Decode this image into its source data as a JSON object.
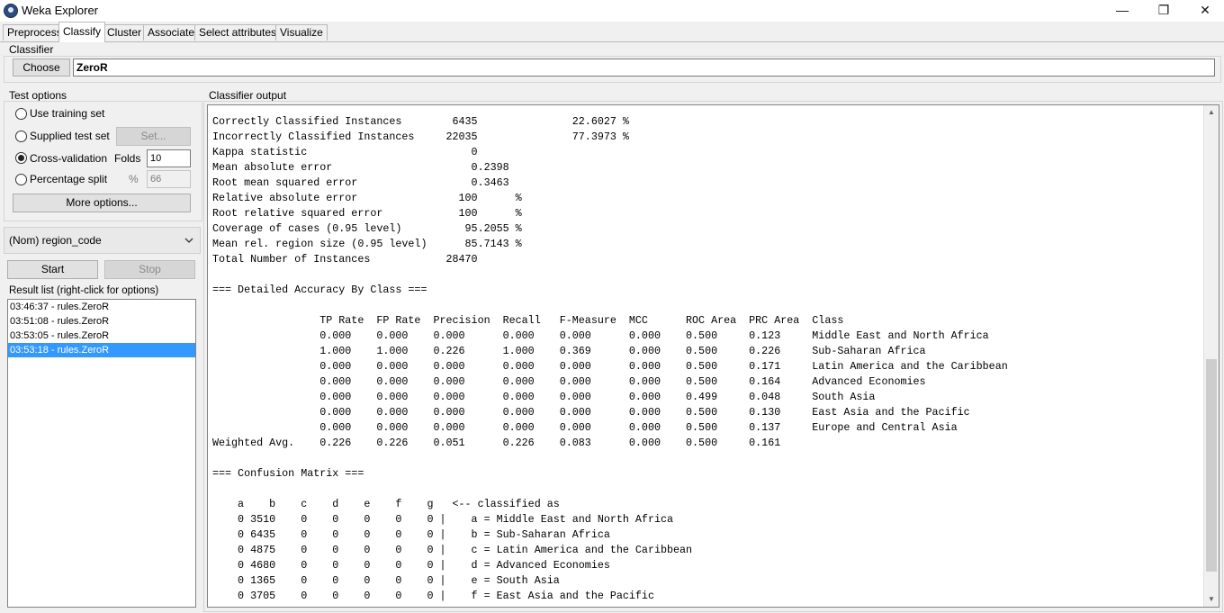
{
  "window": {
    "title": "Weka Explorer",
    "minimize": "—",
    "restore": "❐",
    "close": "✕"
  },
  "tabs": [
    "Preprocess",
    "Classify",
    "Cluster",
    "Associate",
    "Select attributes",
    "Visualize"
  ],
  "active_tab": "Classify",
  "classifier": {
    "group_label": "Classifier",
    "choose_label": "Choose",
    "name": "ZeroR"
  },
  "test_options": {
    "group_label": "Test options",
    "use_training_set": "Use training set",
    "supplied_test_set": "Supplied test set",
    "set_button": "Set...",
    "cross_validation": "Cross-validation",
    "folds_label": "Folds",
    "folds_value": "10",
    "percentage_split": "Percentage split",
    "percent_symbol": "%",
    "percent_value": "66",
    "more_options": "More options...",
    "selected": "Cross-validation"
  },
  "class_attribute": {
    "value": "(Nom) region_code"
  },
  "run": {
    "start_label": "Start",
    "stop_label": "Stop"
  },
  "result_list": {
    "label": "Result list (right-click for options)",
    "items": [
      "03:46:37 - rules.ZeroR",
      "03:51:08 - rules.ZeroR",
      "03:53:05 - rules.ZeroR",
      "03:53:18 - rules.ZeroR"
    ],
    "selected_index": 3
  },
  "output": {
    "label": "Classifier output",
    "text": "Correctly Classified Instances        6435               22.6027 %\nIncorrectly Classified Instances     22035               77.3973 %\nKappa statistic                          0\nMean absolute error                      0.2398\nRoot mean squared error                  0.3463\nRelative absolute error                100      %\nRoot relative squared error            100      %\nCoverage of cases (0.95 level)          95.2055 %\nMean rel. region size (0.95 level)      85.7143 %\nTotal Number of Instances            28470\n\n=== Detailed Accuracy By Class ===\n\n                 TP Rate  FP Rate  Precision  Recall   F-Measure  MCC      ROC Area  PRC Area  Class\n                 0.000    0.000    0.000      0.000    0.000      0.000    0.500     0.123     Middle East and North Africa\n                 1.000    1.000    0.226      1.000    0.369      0.000    0.500     0.226     Sub-Saharan Africa\n                 0.000    0.000    0.000      0.000    0.000      0.000    0.500     0.171     Latin America and the Caribbean\n                 0.000    0.000    0.000      0.000    0.000      0.000    0.500     0.164     Advanced Economies\n                 0.000    0.000    0.000      0.000    0.000      0.000    0.499     0.048     South Asia\n                 0.000    0.000    0.000      0.000    0.000      0.000    0.500     0.130     East Asia and the Pacific\n                 0.000    0.000    0.000      0.000    0.000      0.000    0.500     0.137     Europe and Central Asia\nWeighted Avg.    0.226    0.226    0.051      0.226    0.083      0.000    0.500     0.161\n\n=== Confusion Matrix ===\n\n    a    b    c    d    e    f    g   <-- classified as\n    0 3510    0    0    0    0    0 |    a = Middle East and North Africa\n    0 6435    0    0    0    0    0 |    b = Sub-Saharan Africa\n    0 4875    0    0    0    0    0 |    c = Latin America and the Caribbean\n    0 4680    0    0    0    0    0 |    d = Advanced Economies\n    0 1365    0    0    0    0    0 |    e = South Asia\n    0 3705    0    0    0    0    0 |    f = East Asia and the Pacific"
  },
  "icons": {
    "app": "weka-bird-icon",
    "combo_arrow": "chevron-down-icon",
    "scroll_up": "scroll-up-arrow-icon",
    "scroll_down": "scroll-down-arrow-icon"
  },
  "colors": {
    "selection": "#3399ff",
    "background": "#f0f0f0"
  }
}
